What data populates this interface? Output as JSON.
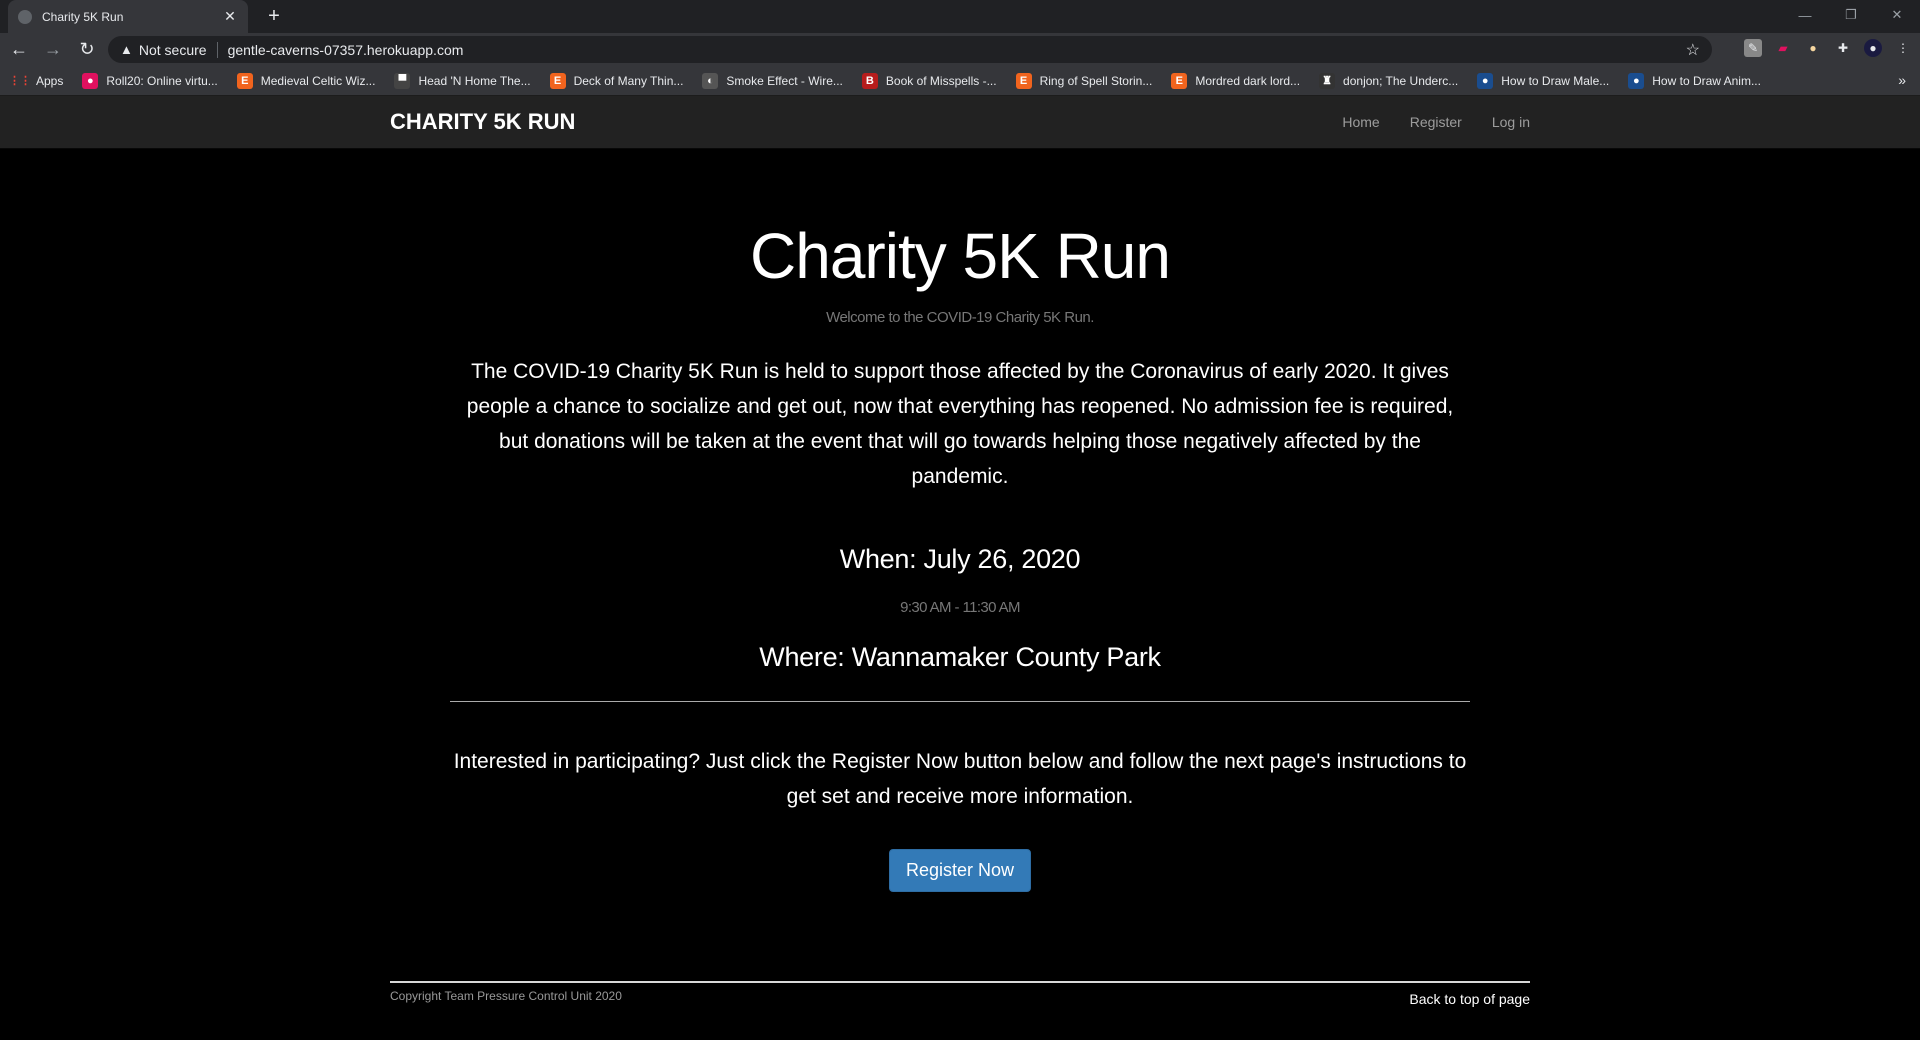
{
  "browser": {
    "tab_title": "Charity 5K Run",
    "security_label": "Not secure",
    "url": "gentle-caverns-07357.herokuapp.com",
    "bookmarks": [
      {
        "label": "Apps",
        "icon": "apps-grid-icon",
        "color": "#ea4335",
        "glyph": "⋮⋮"
      },
      {
        "label": "Roll20: Online virtu...",
        "icon": "roll20-icon",
        "color": "#e0115f",
        "glyph": "●"
      },
      {
        "label": "Medieval Celtic Wiz...",
        "icon": "etsy-icon",
        "color": "#f1641e",
        "glyph": "E"
      },
      {
        "label": "Head 'N Home The...",
        "icon": "site-icon",
        "color": "#444",
        "glyph": "▀"
      },
      {
        "label": "Deck of Many Thin...",
        "icon": "etsy-icon",
        "color": "#f1641e",
        "glyph": "E"
      },
      {
        "label": "Smoke Effect - Wire...",
        "icon": "globe-icon",
        "color": "#555",
        "glyph": "◐"
      },
      {
        "label": "Book of Misspells -...",
        "icon": "book-icon",
        "color": "#b71c1c",
        "glyph": "B"
      },
      {
        "label": "Ring of Spell Storin...",
        "icon": "etsy-icon",
        "color": "#f1641e",
        "glyph": "E"
      },
      {
        "label": "Mordred dark lord...",
        "icon": "etsy-icon",
        "color": "#f1641e",
        "glyph": "E"
      },
      {
        "label": "donjon; The Underc...",
        "icon": "donjon-icon",
        "color": "#333",
        "glyph": "♜"
      },
      {
        "label": "How to Draw Male...",
        "icon": "site-icon",
        "color": "#1a4d8f",
        "glyph": "●"
      },
      {
        "label": "How to Draw Anim...",
        "icon": "site-icon",
        "color": "#1a4d8f",
        "glyph": "●"
      }
    ]
  },
  "site": {
    "brand": "CHARITY 5K RUN",
    "nav": [
      "Home",
      "Register",
      "Log in"
    ]
  },
  "main": {
    "title": "Charity 5K Run",
    "subtitle": "Welcome to the COVID-19 Charity 5K Run.",
    "description": "The COVID-19 Charity 5K Run is held to support those affected by the Coronavirus of early 2020. It gives people a chance to socialize and get out, now that everything has reopened. No admission fee is required, but donations will be taken at the event that will go towards helping those negatively affected by the pandemic.",
    "when": "When: July 26, 2020",
    "time": "9:30 AM - 11:30 AM",
    "where": "Where: Wannamaker County Park",
    "cta": "Interested in participating? Just click the Register Now button below and follow the next page's instructions to get set and receive more information.",
    "register_button": "Register Now"
  },
  "footer": {
    "copyright": "Copyright Team Pressure Control Unit 2020",
    "back_to_top": "Back to top of page"
  }
}
